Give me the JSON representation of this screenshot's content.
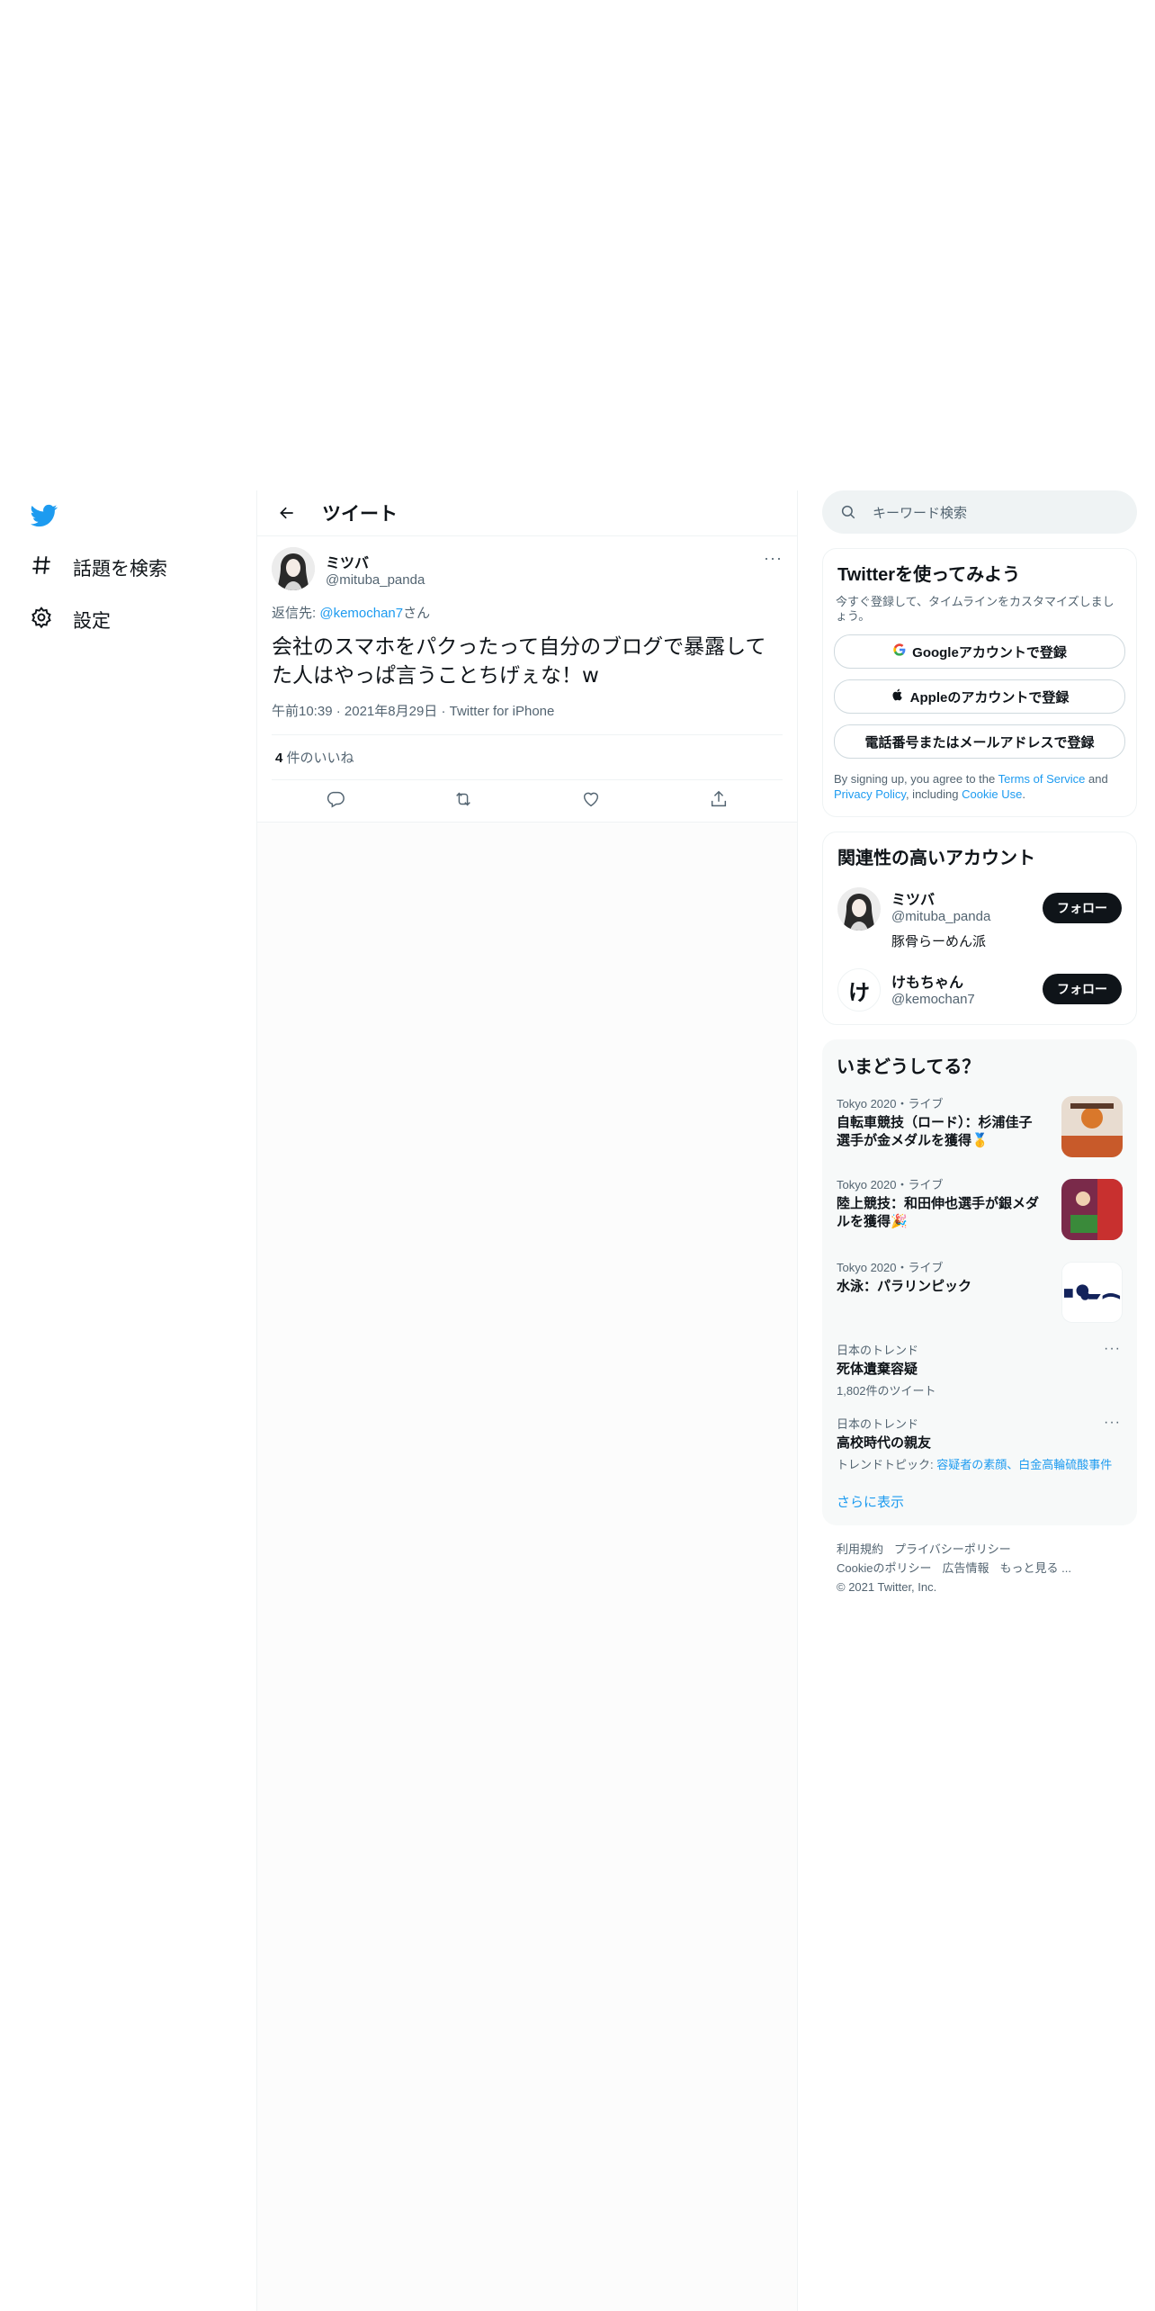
{
  "nav": {
    "items": [
      {
        "label": "話題を検索",
        "icon": "hashtag-icon"
      },
      {
        "label": "設定",
        "icon": "gear-icon"
      }
    ]
  },
  "header": {
    "title": "ツイート"
  },
  "tweet": {
    "name": "ミツバ",
    "handle": "@mituba_panda",
    "reply_prefix": "返信先: ",
    "reply_to": "@kemochan7",
    "reply_suffix": "さん",
    "text": "会社のスマホをパクったって自分のブログで暴露してた人はやっぱ言うことちげぇな！w",
    "time": "午前10:39",
    "date": "2021年8月29日",
    "source": "Twitter for iPhone",
    "likes_count": "4",
    "likes_label": " 件のいいね"
  },
  "search": {
    "placeholder": "キーワード検索"
  },
  "signup": {
    "title": "Twitterを使ってみよう",
    "subtitle": "今すぐ登録して、タイムラインをカスタマイズしましょう。",
    "google": "Googleアカウントで登録",
    "apple": "Appleのアカウントで登録",
    "phone": "電話番号またはメールアドレスで登録",
    "legal_1": "By signing up, you agree to the ",
    "terms": "Terms of Service",
    "legal_2": " and ",
    "privacy": "Privacy Policy",
    "legal_3": ", including ",
    "cookie": "Cookie Use",
    "legal_4": "."
  },
  "related": {
    "title": "関連性の高いアカウント",
    "follow_label": "フォロー",
    "accounts": [
      {
        "name": "ミツバ",
        "handle": "@mituba_panda",
        "bio": "豚骨らーめん派"
      },
      {
        "name": "けもちゃん",
        "handle": "@kemochan7",
        "avatar_char": "け"
      }
    ]
  },
  "trends": {
    "title": "いまどうしてる？",
    "items": [
      {
        "category": "Tokyo 2020・ライブ",
        "title": "自転車競技（ロード）：杉浦佳子選手が金メダルを獲得🥇"
      },
      {
        "category": "Tokyo 2020・ライブ",
        "title": "陸上競技：和田伸也選手が銀メダルを獲得🎉"
      },
      {
        "category": "Tokyo 2020・ライブ",
        "title": "水泳：パラリンピック"
      },
      {
        "category": "日本のトレンド",
        "title": "死体遺棄容疑",
        "sub": "1,802件のツイート"
      },
      {
        "category": "日本のトレンド",
        "title": "高校時代の親友",
        "sub_prefix": "トレンドトピック: ",
        "sub_link": "容疑者の素顔、白金高輪硫酸事件"
      }
    ],
    "show_more": "さらに表示"
  },
  "footer": {
    "terms": "利用規約",
    "privacy": "プライバシーポリシー",
    "cookie": "Cookieのポリシー",
    "ads": "広告情報",
    "more": "もっと見る ...",
    "copyright": "© 2021 Twitter, Inc."
  },
  "colors": {
    "accent": "#1d9bf0",
    "text": "#0f1419",
    "muted": "#536471"
  }
}
